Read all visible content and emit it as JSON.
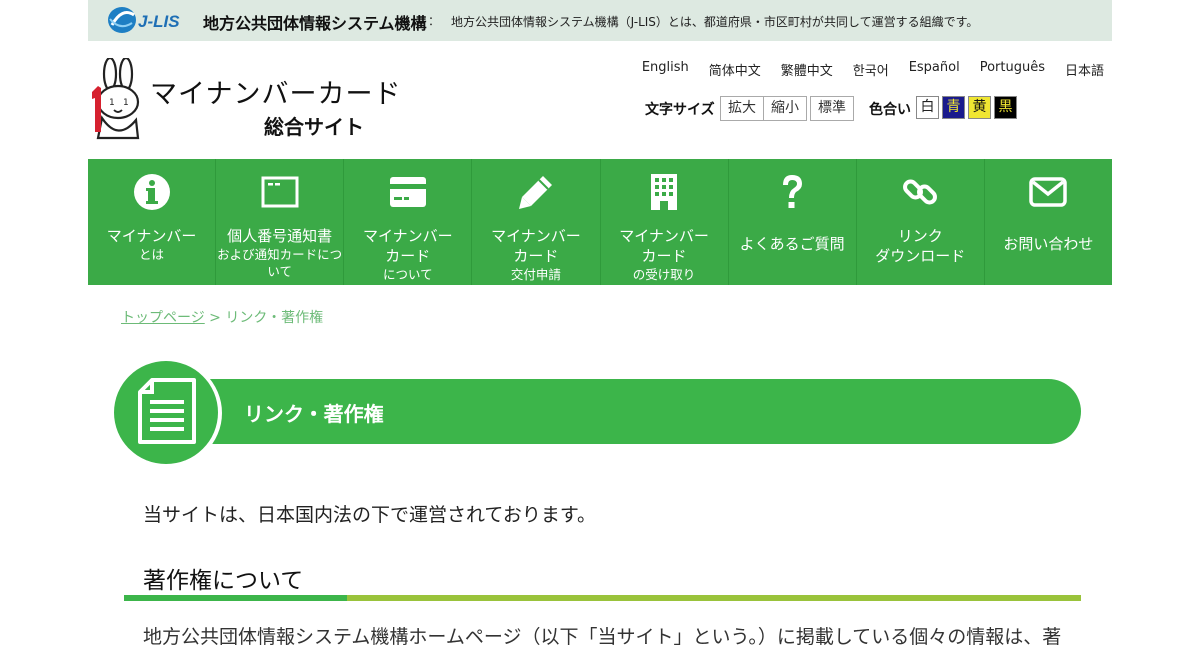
{
  "topbar": {
    "logo_text": "J-LIS",
    "org_name": "地方公共団体情報システム機構",
    "separator": "：",
    "description": "地方公共団体情報システム機構（J-LIS）とは、都道府県・市区町村が共同して運営する組織です。"
  },
  "header": {
    "title": "マイナンバーカード",
    "subtitle": "総合サイト"
  },
  "languages": [
    "English",
    "简体中文",
    "繁體中文",
    "한국어",
    "Español",
    "Português",
    "日本語"
  ],
  "font_size": {
    "label": "文字サイズ",
    "enlarge": "拡大",
    "shrink": "縮小",
    "standard": "標準"
  },
  "color_scheme": {
    "label": "色合い",
    "white": "白",
    "blue": "青",
    "yellow": "黄",
    "black": "黒",
    "colors": {
      "white": "#ffffff",
      "blue": "#1a1a8c",
      "yellow": "#f0e632",
      "black": "#000000"
    }
  },
  "nav": [
    {
      "icon": "info-icon",
      "line1": "マイナンバー",
      "sub": "とは"
    },
    {
      "icon": "card-outline-icon",
      "line1": "個人番号通知書",
      "sub": "および通知カードについて"
    },
    {
      "icon": "credit-card-icon",
      "line1": "マイナンバー",
      "line2": "カード",
      "sub": "について"
    },
    {
      "icon": "pencil-icon",
      "line1": "マイナンバー",
      "line2": "カード",
      "sub": "交付申請"
    },
    {
      "icon": "building-icon",
      "line1": "マイナンバー",
      "line2": "カード",
      "sub": "の受け取り"
    },
    {
      "icon": "question-icon",
      "line1": "よくあるご質問"
    },
    {
      "icon": "link-icon",
      "line1": "リンク",
      "line2": "ダウンロード"
    },
    {
      "icon": "mail-icon",
      "line1": "お問い合わせ"
    }
  ],
  "breadcrumb": {
    "home": "トップページ",
    "separator": " > ",
    "current": "リンク・著作権"
  },
  "page": {
    "title": "リンク・著作権",
    "intro": "当サイトは、日本国内法の下で運営されております。",
    "section_heading": "著作権について",
    "section_body_start": "地方公共団体情報システム機構ホームページ（以下「当サイト」という。）に掲載している個々の情報は、著"
  },
  "colors": {
    "nav_green": "#3baa47",
    "banner_green": "#3cb54a",
    "accent_lime": "#9ac33b",
    "topbar_bg": "#dde9e1"
  }
}
